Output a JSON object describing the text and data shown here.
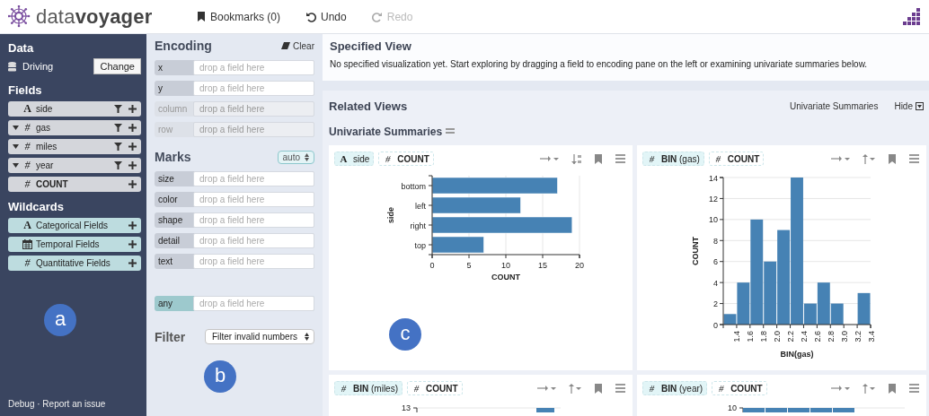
{
  "app": {
    "logo": "data**voyager**",
    "toolbar": [
      {
        "kind": "bookmark",
        "label": "Bookmarks (0)",
        "disabled": false
      },
      {
        "kind": "undo",
        "label": "Undo",
        "disabled": false
      },
      {
        "kind": "redo",
        "label": "Redo",
        "disabled": true
      }
    ]
  },
  "data_pane": {
    "title": "Data",
    "dataset": "Driving",
    "change_button": "Change",
    "fields_title": "Fields",
    "fields": [
      {
        "kind": "nominal",
        "icon": "A",
        "name": "side",
        "expandable": false,
        "filter": true,
        "bold": false
      },
      {
        "kind": "quantitative",
        "icon": "#",
        "name": "gas",
        "expandable": true,
        "filter": true,
        "bold": false
      },
      {
        "kind": "quantitative",
        "icon": "#",
        "name": "miles",
        "expandable": true,
        "filter": true,
        "bold": false
      },
      {
        "kind": "quantitative",
        "icon": "#",
        "name": "year",
        "expandable": true,
        "filter": true,
        "bold": false
      },
      {
        "kind": "quantitative",
        "icon": "#",
        "name": "COUNT",
        "expandable": false,
        "filter": false,
        "bold": true
      }
    ],
    "wildcards_title": "Wildcards",
    "wildcards": [
      {
        "kind": "nominal",
        "icon": "A",
        "name": "Categorical Fields"
      },
      {
        "kind": "temporal",
        "name": "Temporal Fields"
      },
      {
        "kind": "quantitative",
        "icon": "#",
        "name": "Quantitative Fields"
      }
    ],
    "footer": "Debug · Report an issue"
  },
  "encoding_pane": {
    "title": "Encoding",
    "clear": "Clear",
    "shelves": [
      {
        "channel": "x",
        "placeholder": "drop a field here",
        "disabled": false
      },
      {
        "channel": "y",
        "placeholder": "drop a field here",
        "disabled": false
      },
      {
        "channel": "column",
        "placeholder": "drop a field here",
        "disabled": true
      },
      {
        "channel": "row",
        "placeholder": "drop a field here",
        "disabled": true
      }
    ],
    "marks_title": "Marks",
    "mark_select": "auto",
    "mark_shelves": [
      {
        "channel": "size",
        "placeholder": "drop a field here",
        "disabled": false
      },
      {
        "channel": "color",
        "placeholder": "drop a field here",
        "disabled": false
      },
      {
        "channel": "shape",
        "placeholder": "drop a field here",
        "disabled": false
      },
      {
        "channel": "detail",
        "placeholder": "drop a field here",
        "disabled": false
      },
      {
        "channel": "text",
        "placeholder": "drop a field here",
        "disabled": false
      }
    ],
    "wildcard_shelf": {
      "channel": "any",
      "placeholder": "drop a field here"
    },
    "filter_title": "Filter",
    "filter_select": "Filter invalid numbers"
  },
  "specified_view": {
    "title": "Specified View",
    "message": "No specified visualization yet. Start exploring by dragging a field to encoding pane on the left or examining univariate summaries below."
  },
  "related_views": {
    "title": "Related Views",
    "link": "Univariate Summaries",
    "hide": "Hide",
    "section_title": "Univariate Summaries",
    "cards": [
      {
        "pills": [
          {
            "kind": "nominal",
            "icon": "A",
            "label": "side",
            "bold": false,
            "highlighted": true
          },
          {
            "kind": "quantitative",
            "icon": "#",
            "label": "COUNT",
            "bold": true,
            "highlighted": false
          }
        ],
        "tools": [
          {
            "kind": "swap"
          },
          {
            "kind": "sort"
          },
          {
            "kind": "bookmark"
          },
          {
            "kind": "list"
          }
        ],
        "chart_data": {
          "type": "bar",
          "orientation": "horizontal",
          "xlabel": "COUNT",
          "ylabel": "side",
          "categories": [
            "bottom",
            "left",
            "right",
            "top"
          ],
          "values": [
            17,
            12,
            19,
            7
          ],
          "xlim": [
            0,
            20
          ],
          "xticks": [
            0,
            5,
            10,
            15,
            20
          ],
          "grid": true
        }
      },
      {
        "pills": [
          {
            "kind": "quantitative",
            "icon": "#",
            "label": "**BIN** (gas)",
            "bold": false,
            "highlighted": true
          },
          {
            "kind": "quantitative",
            "icon": "#",
            "label": "COUNT",
            "bold": true,
            "highlighted": false
          }
        ],
        "tools": [
          {
            "kind": "swap"
          },
          {
            "kind": "up"
          },
          {
            "kind": "bookmark"
          },
          {
            "kind": "list"
          }
        ],
        "chart_data": {
          "type": "bar",
          "xlabel": "BIN(gas)",
          "ylabel": "COUNT",
          "x": [
            1.3,
            1.5,
            1.7,
            1.9,
            2.1,
            2.3,
            2.5,
            2.7,
            2.9,
            3.1,
            3.3
          ],
          "values": [
            1,
            4,
            10,
            6,
            9,
            14,
            2,
            4,
            2,
            0,
            3
          ],
          "xlim": [
            1.2,
            3.4
          ],
          "ylim": [
            0,
            14
          ],
          "xticks": [
            {
              "value": 1.4,
              "label": "1.4"
            },
            {
              "value": 1.6,
              "label": "1.6"
            },
            {
              "value": 1.8,
              "label": "1.8"
            },
            {
              "value": 2.0,
              "label": "2.0"
            },
            {
              "value": 2.2,
              "label": "2.2"
            },
            {
              "value": 2.4,
              "label": "2.4"
            },
            {
              "value": 2.6,
              "label": "2.6"
            },
            {
              "value": 2.8,
              "label": "2.8"
            },
            {
              "value": 3.0,
              "label": "3.0"
            },
            {
              "value": 3.2,
              "label": "3.2"
            },
            {
              "value": 3.4,
              "label": "3.4"
            }
          ],
          "yticks": [
            0,
            2,
            4,
            6,
            8,
            10,
            12,
            14
          ],
          "grid": true
        }
      },
      {
        "pills": [
          {
            "kind": "quantitative",
            "icon": "#",
            "label": "**BIN** (miles)",
            "bold": false,
            "highlighted": true
          },
          {
            "kind": "quantitative",
            "icon": "#",
            "label": "COUNT",
            "bold": true,
            "highlighted": false
          }
        ],
        "tools": [
          {
            "kind": "swap"
          },
          {
            "kind": "up"
          },
          {
            "kind": "bookmark"
          },
          {
            "kind": "list"
          }
        ],
        "top_tick": "13"
      },
      {
        "pills": [
          {
            "kind": "quantitative",
            "icon": "#",
            "label": "**BIN** (year)",
            "bold": false,
            "highlighted": true
          },
          {
            "kind": "quantitative",
            "icon": "#",
            "label": "COUNT",
            "bold": true,
            "highlighted": false
          }
        ],
        "tools": [
          {
            "kind": "swap"
          },
          {
            "kind": "up"
          },
          {
            "kind": "bookmark"
          },
          {
            "kind": "list"
          }
        ],
        "top_tick": "10"
      }
    ]
  },
  "annotations": [
    {
      "label": "a"
    },
    {
      "label": "b"
    },
    {
      "label": "c"
    }
  ]
}
